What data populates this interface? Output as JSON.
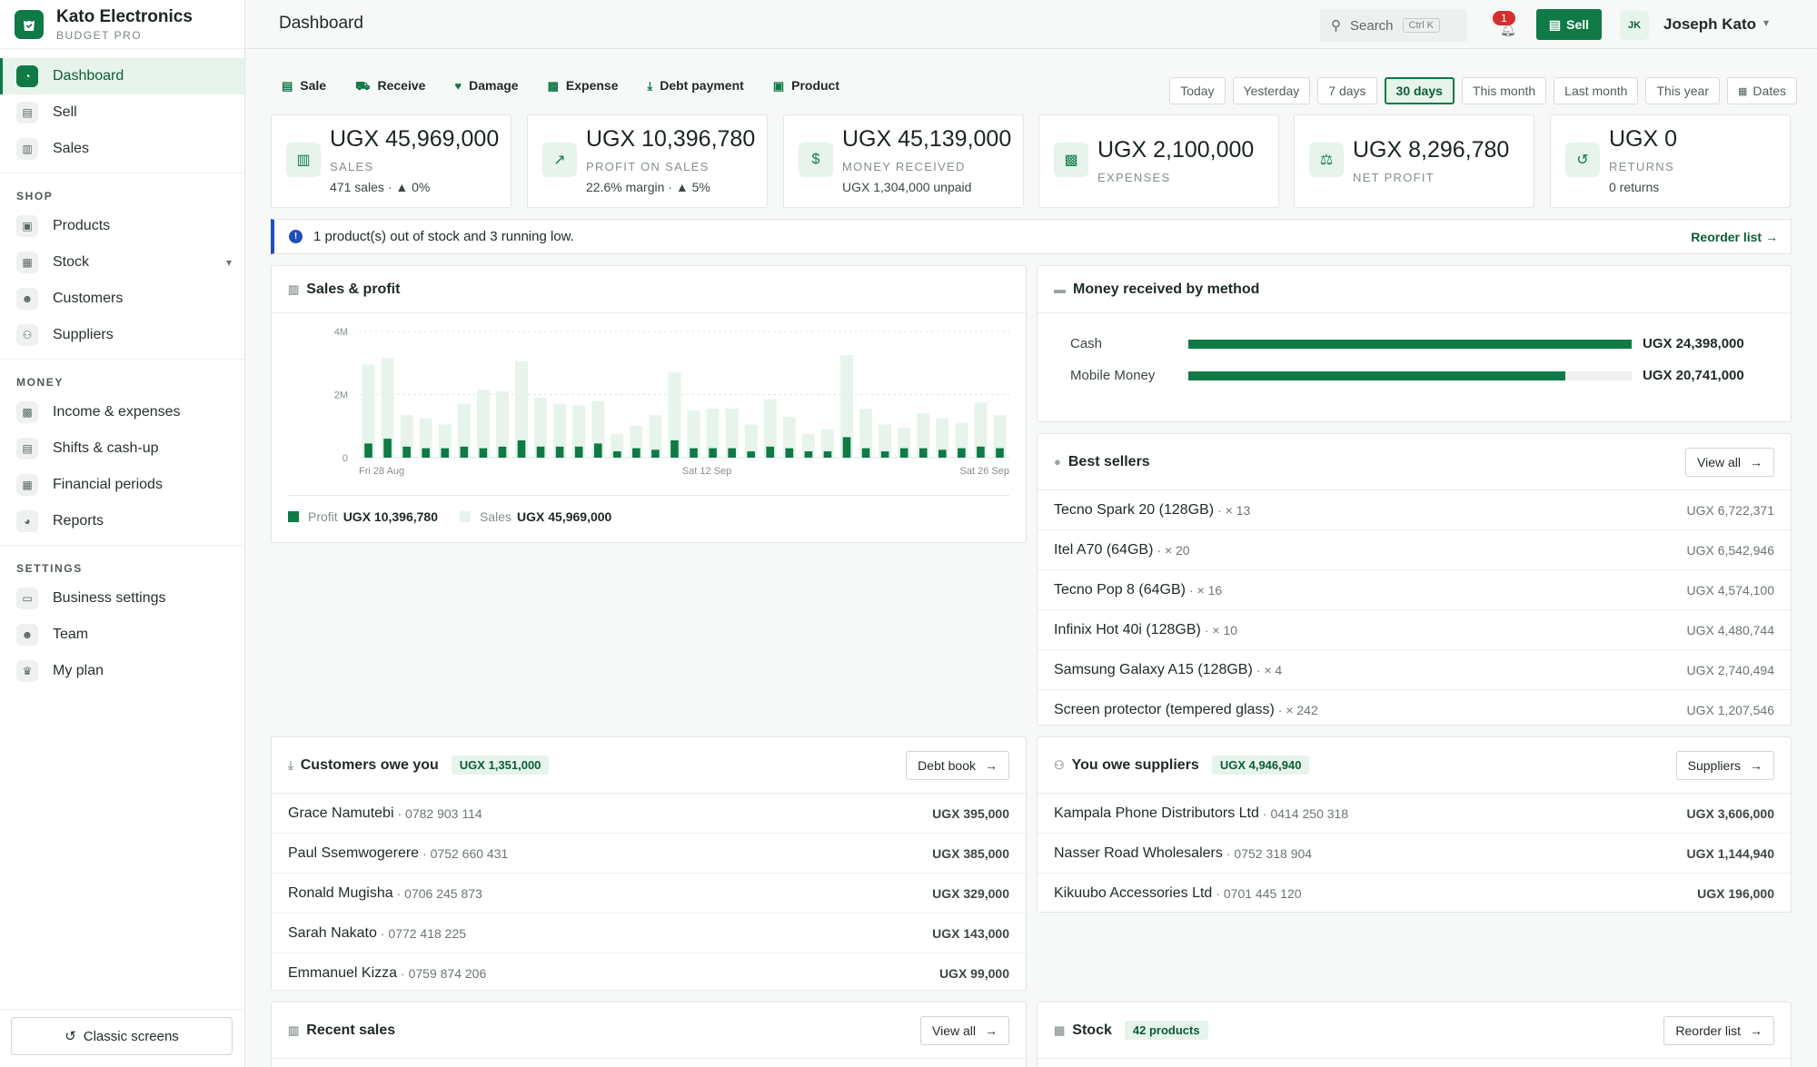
{
  "brand": {
    "name": "Kato Electronics",
    "plan": "BUDGET PRO"
  },
  "nav": {
    "main": [
      {
        "label": "Dashboard",
        "icon": "gauge-icon"
      },
      {
        "label": "Sell",
        "icon": "register-icon"
      },
      {
        "label": "Sales",
        "icon": "receipt-icon"
      }
    ],
    "shop_title": "SHOP",
    "shop": [
      {
        "label": "Products",
        "icon": "box-icon"
      },
      {
        "label": "Stock",
        "icon": "warehouse-icon"
      },
      {
        "label": "Customers",
        "icon": "users-icon"
      },
      {
        "label": "Suppliers",
        "icon": "handshake-icon"
      }
    ],
    "money_title": "MONEY",
    "money": [
      {
        "label": "Income & expenses",
        "icon": "money-icon"
      },
      {
        "label": "Shifts & cash-up",
        "icon": "cash-register-icon"
      },
      {
        "label": "Financial periods",
        "icon": "calendar-icon"
      },
      {
        "label": "Reports",
        "icon": "pie-chart-icon"
      }
    ],
    "settings_title": "SETTINGS",
    "settings": [
      {
        "label": "Business settings",
        "icon": "store-icon"
      },
      {
        "label": "Team",
        "icon": "team-icon"
      },
      {
        "label": "My plan",
        "icon": "crown-icon"
      }
    ],
    "classic": "Classic screens"
  },
  "topbar": {
    "title": "Dashboard",
    "search": "Search",
    "shortcut": "Ctrl K",
    "notifications": "1",
    "sell": "Sell",
    "initials": "JK",
    "user": "Joseph Kato"
  },
  "actions": [
    "Sale",
    "Receive",
    "Damage",
    "Expense",
    "Debt payment",
    "Product"
  ],
  "ranges": [
    "Today",
    "Yesterday",
    "7 days",
    "30 days",
    "This month",
    "Last month",
    "This year",
    "Dates"
  ],
  "kpis": [
    {
      "value": "UGX 45,969,000",
      "label": "SALES",
      "sub": "471 sales · ▲ 0%"
    },
    {
      "value": "UGX 10,396,780",
      "label": "PROFIT ON SALES",
      "sub": "22.6% margin · ▲ 5%"
    },
    {
      "value": "UGX 45,139,000",
      "label": "MONEY RECEIVED",
      "sub": "UGX 1,304,000 unpaid"
    },
    {
      "value": "UGX 2,100,000",
      "label": "EXPENSES",
      "sub": ""
    },
    {
      "value": "UGX 8,296,780",
      "label": "NET PROFIT",
      "sub": ""
    },
    {
      "value": "UGX 0",
      "label": "RETURNS",
      "sub": "0 returns"
    }
  ],
  "alert": {
    "text": "1 product(s) out of stock and 3 running low.",
    "link": "Reorder list →"
  },
  "sales_panel": {
    "title": "Sales & profit",
    "legend_profit": "Profit",
    "legend_profit_value": "UGX 10,396,780",
    "legend_sales": "Sales",
    "legend_sales_value": "UGX 45,969,000"
  },
  "chart_data": {
    "type": "bar",
    "title": "Sales & profit",
    "y_ticks": [
      "4M",
      "2M",
      "0"
    ],
    "ylim": [
      0,
      4200000
    ],
    "x_ticks": [
      "Fri 28 Aug",
      "Sat 12 Sep",
      "Sat 26 Sep"
    ],
    "series": [
      {
        "name": "Sales",
        "values": [
          2950000,
          3150000,
          1350000,
          1250000,
          1050000,
          1700000,
          2150000,
          2100000,
          3050000,
          1900000,
          1700000,
          1650000,
          1800000,
          750000,
          1000000,
          1350000,
          2700000,
          1500000,
          1550000,
          1550000,
          1050000,
          1850000,
          1300000,
          750000,
          900000,
          3250000,
          1550000,
          1050000,
          950000,
          1400000,
          1250000,
          1100000,
          1750000,
          1350000
        ],
        "color": "#e6f4ec"
      },
      {
        "name": "Profit",
        "values": [
          450000,
          600000,
          350000,
          300000,
          300000,
          350000,
          300000,
          350000,
          550000,
          350000,
          350000,
          350000,
          450000,
          200000,
          300000,
          250000,
          550000,
          300000,
          300000,
          300000,
          200000,
          350000,
          300000,
          200000,
          200000,
          650000,
          300000,
          200000,
          300000,
          300000,
          250000,
          300000,
          350000,
          300000
        ],
        "color": "#0f7a46"
      }
    ]
  },
  "methods": {
    "title": "Money received by method",
    "items": [
      {
        "name": "Cash",
        "value": "UGX 24,398,000",
        "share": 1.0
      },
      {
        "name": "Mobile Money",
        "value": "UGX 20,741,000",
        "share": 0.85
      }
    ]
  },
  "best": {
    "title": "Best sellers",
    "button": "View all",
    "items": [
      {
        "name": "Tecno Spark 20 (128GB)",
        "qty": "· × 13",
        "amount": "UGX 6,722,371"
      },
      {
        "name": "Itel A70 (64GB)",
        "qty": "· × 20",
        "amount": "UGX 6,542,946"
      },
      {
        "name": "Tecno Pop 8 (64GB)",
        "qty": "· × 16",
        "amount": "UGX 4,574,100"
      },
      {
        "name": "Infinix Hot 40i (128GB)",
        "qty": "· × 10",
        "amount": "UGX 4,480,744"
      },
      {
        "name": "Samsung Galaxy A15 (128GB)",
        "qty": "· × 4",
        "amount": "UGX 2,740,494"
      },
      {
        "name": "Screen protector (tempered glass)",
        "qty": "· × 242",
        "amount": "UGX 1,207,546"
      }
    ]
  },
  "owe_you": {
    "title": "Customers owe you",
    "total": "UGX 1,351,000",
    "button": "Debt book",
    "items": [
      {
        "name": "Grace Namutebi",
        "phone": "· 0782 903 114",
        "amount": "UGX 395,000"
      },
      {
        "name": "Paul Ssemwogerere",
        "phone": "· 0752 660 431",
        "amount": "UGX 385,000"
      },
      {
        "name": "Ronald Mugisha",
        "phone": "· 0706 245 873",
        "amount": "UGX 329,000"
      },
      {
        "name": "Sarah Nakato",
        "phone": "· 0772 418 225",
        "amount": "UGX 143,000"
      },
      {
        "name": "Emmanuel Kizza",
        "phone": "· 0759 874 206",
        "amount": "UGX 99,000"
      }
    ]
  },
  "you_owe": {
    "title": "You owe suppliers",
    "total": "UGX 4,946,940",
    "button": "Suppliers",
    "items": [
      {
        "name": "Kampala Phone Distributors Ltd",
        "phone": "· 0414 250 318",
        "amount": "UGX 3,606,000"
      },
      {
        "name": "Nasser Road Wholesalers",
        "phone": "· 0752 318 904",
        "amount": "UGX 1,144,940"
      },
      {
        "name": "Kikuubo Accessories Ltd",
        "phone": "· 0701 445 120",
        "amount": "UGX 196,000"
      }
    ]
  },
  "recent": {
    "title": "Recent sales",
    "button": "View all"
  },
  "stock": {
    "title": "Stock",
    "count": "42 products",
    "button": "Reorder list"
  }
}
